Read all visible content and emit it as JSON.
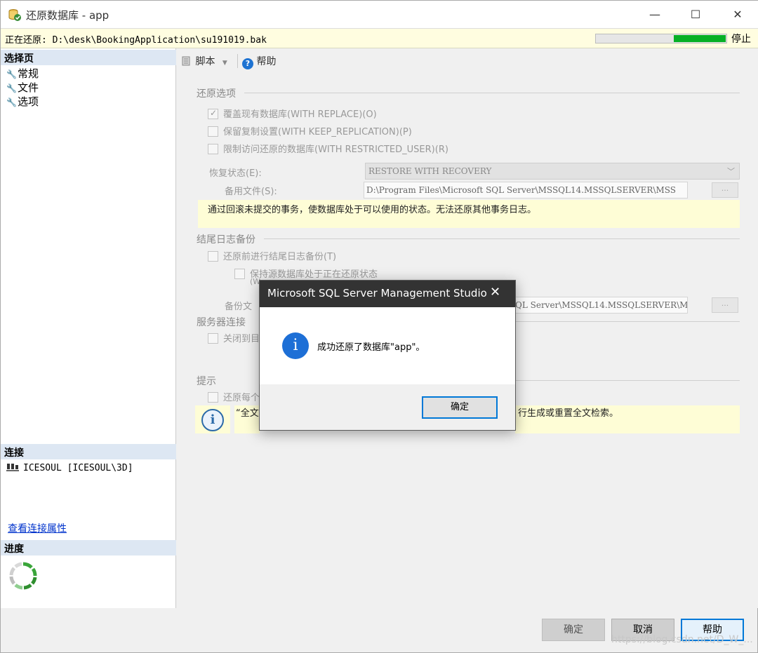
{
  "window": {
    "title": "还原数据库 - app",
    "min_glyph": "—",
    "max_glyph": "☐",
    "close_glyph": "✕"
  },
  "status": {
    "text": "正在还原: D:\\desk\\BookingApplication\\su191019.bak",
    "progress_fraction": 0.4,
    "stop_label": "停止",
    "progress_color": "#06b025"
  },
  "left": {
    "select_page_header": "选择页",
    "nav_items": [
      {
        "label": "常规",
        "icon": "wrench-icon"
      },
      {
        "label": "文件",
        "icon": "wrench-icon"
      },
      {
        "label": "选项",
        "icon": "wrench-icon"
      }
    ],
    "connection_header": "连接",
    "connection_value": "ICESOUL [ICESOUL\\3D]",
    "connection_link": "查看连接属性",
    "progress_header": "进度"
  },
  "toolbar": {
    "script_label": "脚本",
    "help_label": "帮助"
  },
  "restore_options": {
    "title": "还原选项",
    "overwrite": "覆盖现有数据库(WITH REPLACE)(O)",
    "overwrite_checked": true,
    "keep_replication": "保留复制设置(WITH KEEP_REPLICATION)(P)",
    "restrict_access": "限制访问还原的数据库(WITH RESTRICTED_USER)(R)",
    "recovery_state_label": "恢复状态(E):",
    "recovery_state_value": "RESTORE WITH RECOVERY",
    "standby_file_label": "备用文件(S):",
    "standby_file_value": "D:\\Program Files\\Microsoft SQL Server\\MSSQL14.MSSQLSERVER\\MSS",
    "browse_label": "...",
    "info_text": "通过回滚未提交的事务，使数据库处于可以使用的状态。无法还原其他事务日志。"
  },
  "tail_log": {
    "title": "结尾日志备份",
    "backup_before": "还原前进行结尾日志备份(T)",
    "keep_restoring": "保持源数据库处于正在还原状态",
    "keep_restoring_sub": "(W",
    "backup_file_label": "备份文",
    "backup_file_value": "QL Server\\MSSQL14.MSSQLSERVER\\MSS",
    "browse_label": "..."
  },
  "server_conn": {
    "title": "服务器连接",
    "close_label": "关闭到目"
  },
  "hint": {
    "title": "提示",
    "restore_each": "还原每个",
    "info_left": "“全文",
    "info_right": "行生成或重置全文检索。"
  },
  "buttons": {
    "ok": "确定",
    "cancel": "取消",
    "help": "帮助"
  },
  "watermark": "https://blog.csdn.net/D_W_...",
  "modal": {
    "title": "Microsoft SQL Server Management Studio",
    "close_glyph": "✕",
    "icon_glyph": "i",
    "message": "成功还原了数据库\"app\"。",
    "ok_label": "确定"
  }
}
